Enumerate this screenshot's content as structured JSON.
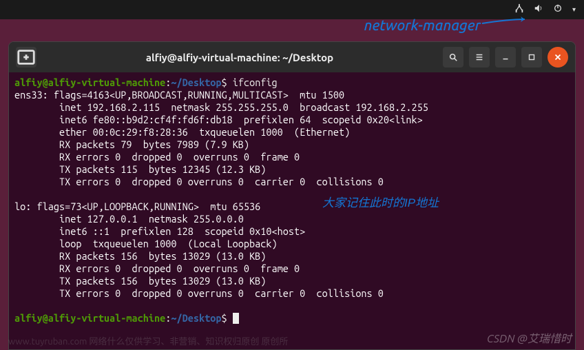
{
  "annotations": {
    "network_manager": "network-manager",
    "ip_note": "大家记住此时的IP地址",
    "watermark": "CSDN @艾瑞惜时",
    "faded": "www.tuyruban.com  网络什么仅供学习、非营销、知识权归原创 原创所"
  },
  "titlebar": {
    "title": "alfiy@alfiy-virtual-machine: ~/Desktop"
  },
  "prompt": {
    "user_host": "alfiy@alfiy-virtual-machine",
    "sep": ":",
    "path": "~/Desktop",
    "dollar": "$"
  },
  "commands": {
    "ifconfig": "ifconfig"
  },
  "output": {
    "ens33_header": "ens33: flags=4163<UP,BROADCAST,RUNNING,MULTICAST>  mtu 1500",
    "ens33_inet": "        inet 192.168.2.115  netmask 255.255.255.0  broadcast 192.168.2.255",
    "ens33_inet6": "        inet6 fe80::b9d2:cf4f:fd6f:db18  prefixlen 64  scopeid 0x20<link>",
    "ens33_ether": "        ether 00:0c:29:f8:28:36  txqueuelen 1000  (Ethernet)",
    "ens33_rxp": "        RX packets 79  bytes 7989 (7.9 KB)",
    "ens33_rxe": "        RX errors 0  dropped 0  overruns 0  frame 0",
    "ens33_txp": "        TX packets 115  bytes 12345 (12.3 KB)",
    "ens33_txe": "        TX errors 0  dropped 0 overruns 0  carrier 0  collisions 0",
    "blank1": "",
    "lo_header": "lo: flags=73<UP,LOOPBACK,RUNNING>  mtu 65536",
    "lo_inet": "        inet 127.0.0.1  netmask 255.0.0.0",
    "lo_inet6": "        inet6 ::1  prefixlen 128  scopeid 0x10<host>",
    "lo_loop": "        loop  txqueuelen 1000  (Local Loopback)",
    "lo_rxp": "        RX packets 156  bytes 13029 (13.0 KB)",
    "lo_rxe": "        RX errors 0  dropped 0  overruns 0  frame 0",
    "lo_txp": "        TX packets 156  bytes 13029 (13.0 KB)",
    "lo_txe": "        TX errors 0  dropped 0 overruns 0  carrier 0  collisions 0",
    "blank2": ""
  }
}
